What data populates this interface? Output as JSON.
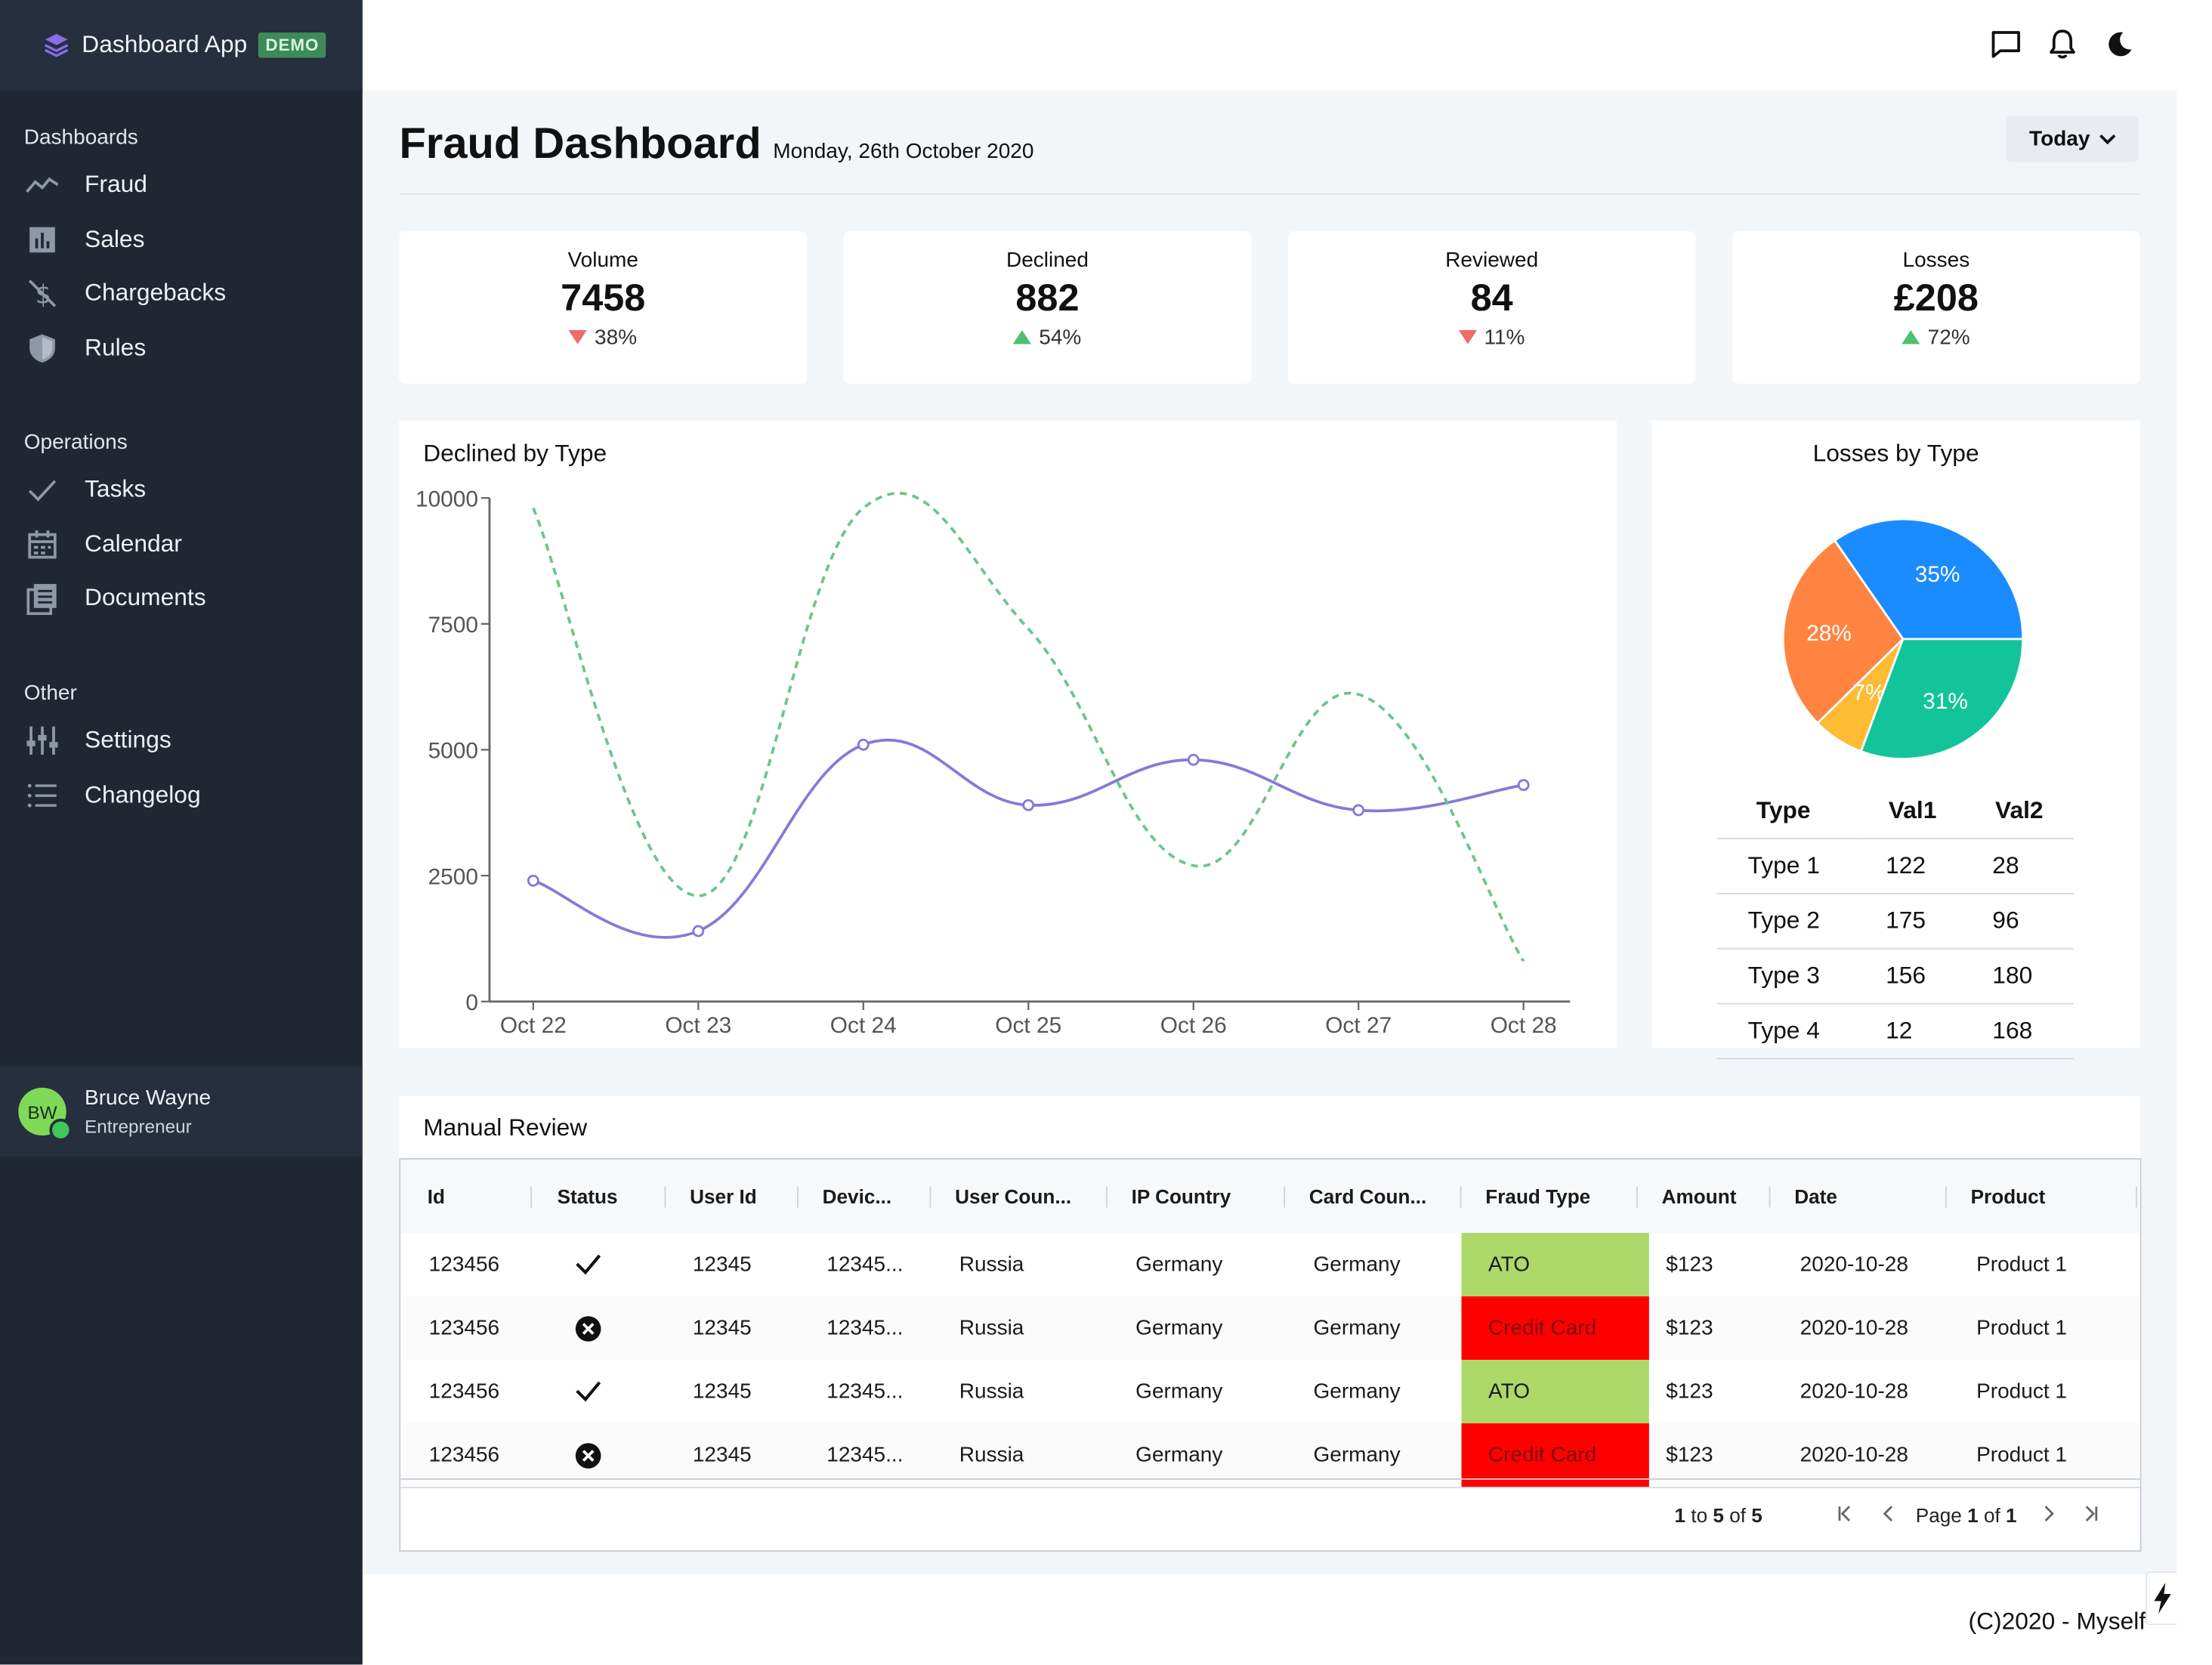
{
  "brand": {
    "title": "Dashboard App",
    "badge": "DEMO"
  },
  "sidebar": {
    "groups": [
      {
        "heading": "Dashboards",
        "items": [
          {
            "label": "Fraud",
            "icon": "trend-line-icon"
          },
          {
            "label": "Sales",
            "icon": "bar-chart-icon"
          },
          {
            "label": "Chargebacks",
            "icon": "no-dollar-icon"
          },
          {
            "label": "Rules",
            "icon": "shield-icon"
          }
        ]
      },
      {
        "heading": "Operations",
        "items": [
          {
            "label": "Tasks",
            "icon": "check-icon"
          },
          {
            "label": "Calendar",
            "icon": "calendar-icon"
          },
          {
            "label": "Documents",
            "icon": "documents-icon"
          }
        ]
      },
      {
        "heading": "Other",
        "items": [
          {
            "label": "Settings",
            "icon": "sliders-icon"
          },
          {
            "label": "Changelog",
            "icon": "list-icon"
          }
        ]
      }
    ],
    "user": {
      "initials": "BW",
      "name": "Bruce Wayne",
      "role": "Entrepreneur"
    }
  },
  "topbar": {
    "icons": [
      "chat-icon",
      "bell-icon",
      "moon-icon"
    ]
  },
  "header": {
    "title": "Fraud Dashboard",
    "date": "Monday, 26th October 2020",
    "range": "Today"
  },
  "kpis": [
    {
      "label": "Volume",
      "value": "7458",
      "change": "38%",
      "direction": "down"
    },
    {
      "label": "Declined",
      "value": "882",
      "change": "54%",
      "direction": "up"
    },
    {
      "label": "Reviewed",
      "value": "84",
      "change": "11%",
      "direction": "down"
    },
    {
      "label": "Losses",
      "value": "£208",
      "change": "72%",
      "direction": "up"
    }
  ],
  "colors": {
    "up": "#4fbf72",
    "down": "#f06a6a",
    "line_solid": "#8878d8",
    "line_dashed": "#6cc58a",
    "ato": "#acd96a",
    "credit_card": "#ff0000"
  },
  "line_chart": {
    "title": "Declined by Type",
    "chart_data": {
      "type": "line",
      "categories": [
        "Oct 22",
        "Oct 23",
        "Oct 24",
        "Oct 25",
        "Oct 26",
        "Oct 27",
        "Oct 28"
      ],
      "yticks": [
        "0",
        "2500",
        "5000",
        "7500",
        "10000"
      ],
      "ylim": [
        0,
        10000
      ],
      "series": [
        {
          "values": [
            2400,
            1400,
            5100,
            3900,
            4800,
            3800,
            4300
          ],
          "color": "#8878d8",
          "style": "solid",
          "markers": true
        },
        {
          "values": [
            9800,
            2100,
            9800,
            7400,
            2700,
            6100,
            800
          ],
          "color": "#6cc58a",
          "style": "dashed",
          "markers": false
        }
      ],
      "grid": false
    }
  },
  "pie_chart": {
    "title": "Losses by Type",
    "chart_data": {
      "type": "pie",
      "slices": [
        {
          "label": "35%",
          "value": 35,
          "color": "#1a8cff"
        },
        {
          "label": "28%",
          "value": 28,
          "color": "#ff8442"
        },
        {
          "label": "7%",
          "value": 7,
          "color": "#ffbb33"
        },
        {
          "label": "31%",
          "value": 31,
          "color": "#12c49a"
        }
      ]
    },
    "table": {
      "headers": [
        "Type",
        "Val1",
        "Val2"
      ],
      "rows": [
        [
          "Type 1",
          "122",
          "28"
        ],
        [
          "Type 2",
          "175",
          "96"
        ],
        [
          "Type 3",
          "156",
          "180"
        ],
        [
          "Type 4",
          "12",
          "168"
        ]
      ]
    }
  },
  "review": {
    "title": "Manual Review",
    "columns": [
      "Id",
      "Status",
      "User Id",
      "Devic...",
      "User Coun...",
      "IP Country",
      "Card Coun...",
      "Fraud Type",
      "Amount",
      "Date",
      "Product"
    ],
    "rows": [
      {
        "id": "123456",
        "status": "approved",
        "user_id": "12345",
        "device": "12345...",
        "user_country": "Russia",
        "ip_country": "Germany",
        "card_country": "Germany",
        "fraud_type": "ATO",
        "amount": "$123",
        "date": "2020-10-28",
        "product": "Product 1"
      },
      {
        "id": "123456",
        "status": "rejected",
        "user_id": "12345",
        "device": "12345...",
        "user_country": "Russia",
        "ip_country": "Germany",
        "card_country": "Germany",
        "fraud_type": "Credit Card",
        "amount": "$123",
        "date": "2020-10-28",
        "product": "Product 1"
      },
      {
        "id": "123456",
        "status": "approved",
        "user_id": "12345",
        "device": "12345...",
        "user_country": "Russia",
        "ip_country": "Germany",
        "card_country": "Germany",
        "fraud_type": "ATO",
        "amount": "$123",
        "date": "2020-10-28",
        "product": "Product 1"
      },
      {
        "id": "123456",
        "status": "rejected",
        "user_id": "12345",
        "device": "12345...",
        "user_country": "Russia",
        "ip_country": "Germany",
        "card_country": "Germany",
        "fraud_type": "Credit Card",
        "amount": "$123",
        "date": "2020-10-28",
        "product": "Product 1"
      }
    ],
    "pager": {
      "from": "1",
      "to_word": "to",
      "to": "5",
      "of_word": "of",
      "total": "5",
      "page_word": "Page",
      "page": "1",
      "pages": "1"
    }
  },
  "footer": {
    "text": "(C)2020 - Myself"
  }
}
